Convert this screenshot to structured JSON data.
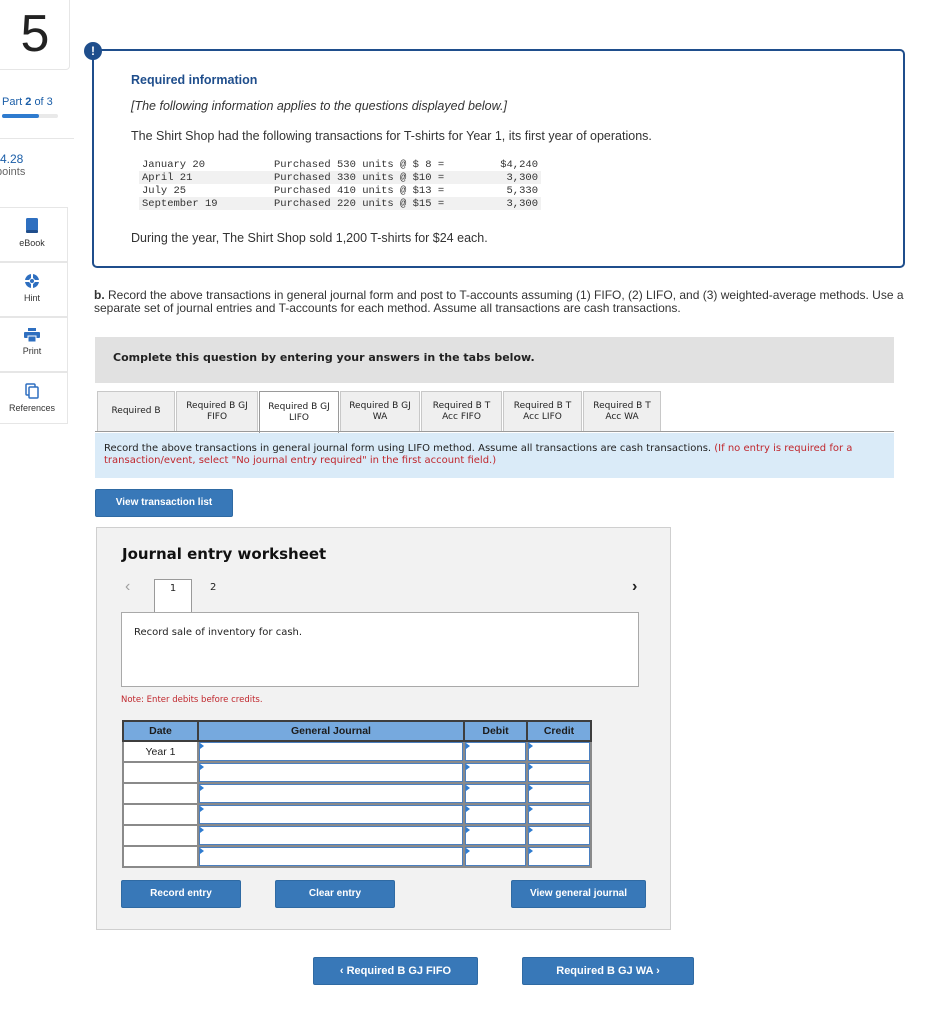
{
  "sidebar": {
    "question_number": "5",
    "part_label": "Part",
    "part_current": "2",
    "part_of": "of 3",
    "part_progress_fraction": 0.667,
    "points_value": "4.28",
    "points_label": "points",
    "tools": [
      {
        "icon": "book-icon",
        "label": "eBook"
      },
      {
        "icon": "lifebuoy-icon",
        "label": "Hint"
      },
      {
        "icon": "printer-icon",
        "label": "Print"
      },
      {
        "icon": "copy-icon",
        "label": "References"
      }
    ]
  },
  "info": {
    "alert_glyph": "!",
    "title": "Required information",
    "italic_note": "[The following information applies to the questions displayed below.]",
    "intro": "The Shirt Shop had the following transactions for T-shirts for Year 1, its first year of operations.",
    "transactions": [
      {
        "date": "January 20",
        "desc": "Purchased 530 units @ $ 8 =",
        "amount": "$4,240"
      },
      {
        "date": "April 21",
        "desc": "Purchased 330 units @ $10 =",
        "amount": "3,300"
      },
      {
        "date": "July 25",
        "desc": "Purchased 410 units @ $13 =",
        "amount": "5,330"
      },
      {
        "date": "September 19",
        "desc": "Purchased 220 units @ $15 =",
        "amount": "3,300"
      }
    ],
    "sold": "During the year, The Shirt Shop sold 1,200 T-shirts for $24 each."
  },
  "question": {
    "label": "b.",
    "text": " Record the above transactions in general journal form and post to T-accounts assuming (1) FIFO, (2) LIFO, and (3) weighted-average methods. Use a separate set of journal entries and T-accounts for each method. Assume all transactions are cash transactions."
  },
  "complete_prompt": "Complete this question by entering your answers in the tabs below.",
  "tabs": [
    {
      "line1": "Required B",
      "line2": "",
      "active": false
    },
    {
      "line1": "Required B GJ",
      "line2": "FIFO",
      "active": false
    },
    {
      "line1": "Required B GJ",
      "line2": "LIFO",
      "active": true
    },
    {
      "line1": "Required B GJ",
      "line2": "WA",
      "active": false
    },
    {
      "line1": "Required B T",
      "line2": "Acc FIFO",
      "active": false
    },
    {
      "line1": "Required B T",
      "line2": "Acc LIFO",
      "active": false
    },
    {
      "line1": "Required B T",
      "line2": "Acc WA",
      "active": false
    }
  ],
  "instructions": {
    "main": "Record the above transactions in general journal form using LIFO method. Assume all transactions are cash transactions. ",
    "red": "(If no entry is required for a transaction/event, select \"No journal entry required\" in the first account field.)"
  },
  "view_transaction_list": "View transaction list",
  "worksheet": {
    "title": "Journal entry worksheet",
    "prev_glyph": "‹",
    "next_glyph": "›",
    "pages": [
      "1",
      "2"
    ],
    "active_page": "1",
    "description": "Record sale of inventory for cash.",
    "note": "Note: Enter debits before credits.",
    "columns": [
      "Date",
      "General Journal",
      "Debit",
      "Credit"
    ],
    "rows": [
      {
        "date": "Year 1",
        "account": "",
        "debit": "",
        "credit": ""
      },
      {
        "date": "",
        "account": "",
        "debit": "",
        "credit": ""
      },
      {
        "date": "",
        "account": "",
        "debit": "",
        "credit": ""
      },
      {
        "date": "",
        "account": "",
        "debit": "",
        "credit": ""
      },
      {
        "date": "",
        "account": "",
        "debit": "",
        "credit": ""
      },
      {
        "date": "",
        "account": "",
        "debit": "",
        "credit": ""
      }
    ],
    "buttons": {
      "record": "Record entry",
      "clear": "Clear entry",
      "view_journal": "View general journal"
    }
  },
  "nav": {
    "prev_label": "‹  Required B GJ FIFO",
    "next_label": "Required B GJ WA  ›"
  },
  "colors": {
    "brand_blue": "#1f4e8c",
    "button_blue": "#3878b8",
    "header_blue": "#76a9de",
    "note_red": "#c0272d",
    "instr_bg": "#daebf8"
  }
}
